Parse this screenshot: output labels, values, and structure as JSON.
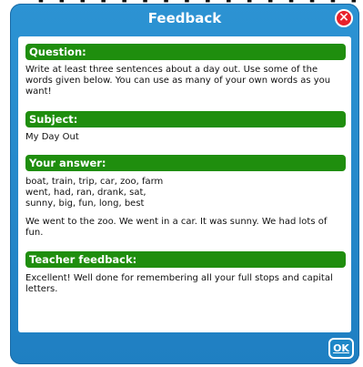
{
  "dialog": {
    "title": "Feedback",
    "close_label": "×",
    "ok_label": "OK"
  },
  "sections": {
    "question": {
      "header": "Question:",
      "text": "Write at least three sentences about a day out. Use some of the words given below. You can use as many of your own words as you want!"
    },
    "subject": {
      "header": "Subject:",
      "text": "My Day Out"
    },
    "answer": {
      "header": "Your answer:",
      "words_line1": "boat, train, trip, car, zoo, farm",
      "words_line2": "went, had, ran, drank, sat,",
      "words_line3": "sunny, big, fun, long, best",
      "text": "We went to the zoo. We went in a car. It was sunny. We had lots of fun."
    },
    "feedback": {
      "header": "Teacher feedback:",
      "text": "Excellent! Well done for remembering all your full stops and capital letters."
    }
  },
  "colors": {
    "dialog_blue": "#1f7fc2",
    "section_green": "#1f8e0e",
    "close_red": "#e8202a"
  }
}
